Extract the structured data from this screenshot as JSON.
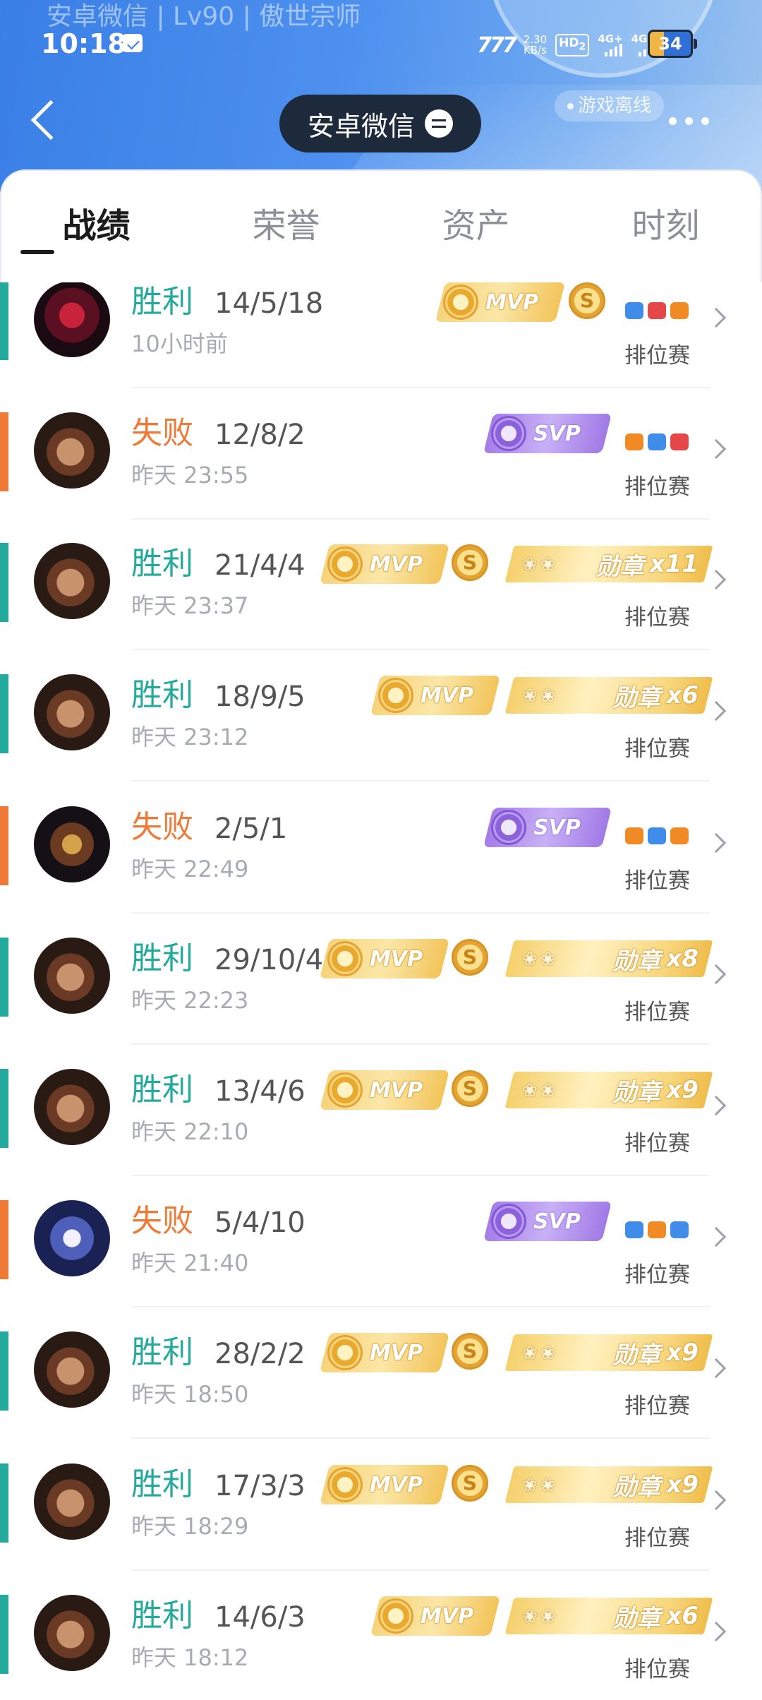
{
  "header": {
    "ghost_text": "安卓微信 | Lv90 | 傲世宗师",
    "status_time": "10:18",
    "net_logo": "777",
    "speed_value": "2.30",
    "speed_unit": "KB/s",
    "hd": "HD",
    "hd_sub": "2",
    "signal1": "4G+",
    "signal2": "4G+",
    "battery": "34",
    "title": "安卓微信",
    "offline": "游戏离线"
  },
  "tabs": [
    {
      "label": "战绩",
      "active": true
    },
    {
      "label": "荣誉"
    },
    {
      "label": "资产"
    },
    {
      "label": "时刻"
    }
  ],
  "badge_text": {
    "mvp": "MVP",
    "svp": "SVP",
    "s": "S",
    "medal": "勋章"
  },
  "matches": [
    {
      "result": "胜利",
      "kda": "14/5/18",
      "time": "10小时前",
      "mode": "排位赛",
      "outcome": "win",
      "mvp": true,
      "s": true,
      "medal": null,
      "icons": [
        "blue",
        "red",
        "orange"
      ]
    },
    {
      "result": "失败",
      "kda": "12/8/2",
      "time": "昨天 23:55",
      "mode": "排位赛",
      "outcome": "loss",
      "svp": true,
      "icons": [
        "orange",
        "blue",
        "red"
      ]
    },
    {
      "result": "胜利",
      "kda": "21/4/4",
      "time": "昨天 23:37",
      "mode": "排位赛",
      "outcome": "win",
      "mvp": true,
      "s": true,
      "medal": "x11"
    },
    {
      "result": "胜利",
      "kda": "18/9/5",
      "time": "昨天 23:12",
      "mode": "排位赛",
      "outcome": "win",
      "mvp": true,
      "medal": "x6"
    },
    {
      "result": "失败",
      "kda": "2/5/1",
      "time": "昨天 22:49",
      "mode": "排位赛",
      "outcome": "loss",
      "svp": true,
      "icons": [
        "orange",
        "blue",
        "orange"
      ]
    },
    {
      "result": "胜利",
      "kda": "29/10/4",
      "time": "昨天 22:23",
      "mode": "排位赛",
      "outcome": "win",
      "mvp": true,
      "s": true,
      "medal": "x8"
    },
    {
      "result": "胜利",
      "kda": "13/4/6",
      "time": "昨天 22:10",
      "mode": "排位赛",
      "outcome": "win",
      "mvp": true,
      "s": true,
      "medal": "x9"
    },
    {
      "result": "失败",
      "kda": "5/4/10",
      "time": "昨天 21:40",
      "mode": "排位赛",
      "outcome": "loss",
      "svp": true,
      "icons": [
        "blue",
        "orange",
        "blue"
      ]
    },
    {
      "result": "胜利",
      "kda": "28/2/2",
      "time": "昨天 18:50",
      "mode": "排位赛",
      "outcome": "win",
      "mvp": true,
      "s": true,
      "medal": "x9"
    },
    {
      "result": "胜利",
      "kda": "17/3/3",
      "time": "昨天 18:29",
      "mode": "排位赛",
      "outcome": "win",
      "mvp": true,
      "s": true,
      "medal": "x9"
    },
    {
      "result": "胜利",
      "kda": "14/6/3",
      "time": "昨天 18:12",
      "mode": "排位赛",
      "outcome": "win",
      "mvp": true,
      "medal": "x6"
    }
  ]
}
